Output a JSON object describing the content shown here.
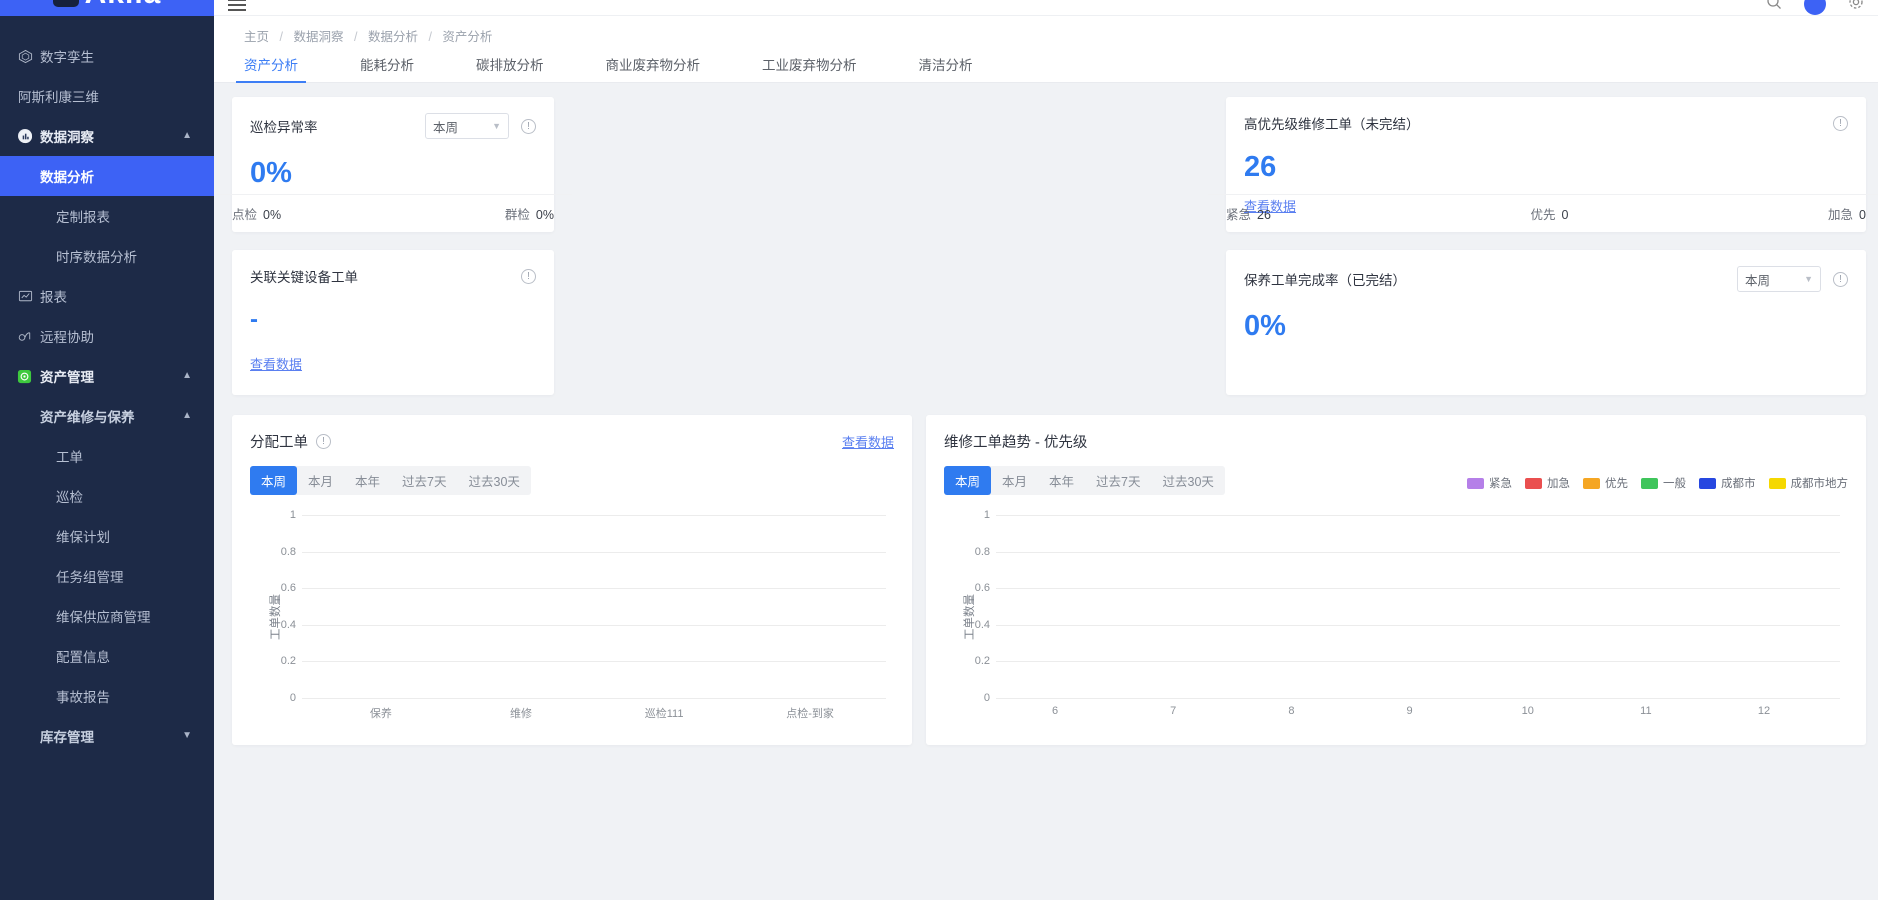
{
  "brand": {
    "logo_text": "Akila"
  },
  "sidebar": {
    "items": [
      {
        "label": "数字孪生",
        "icon": "cube-icon",
        "level": 1,
        "active": false,
        "chevron": ""
      },
      {
        "label": "阿斯利康三维",
        "icon": "",
        "level": 1,
        "active": false,
        "chevron": ""
      },
      {
        "label": "数据洞察",
        "icon": "insight-icon",
        "level": 1,
        "active": false,
        "chevron": "up"
      },
      {
        "label": "数据分析",
        "icon": "",
        "level": 3,
        "active": true,
        "chevron": ""
      },
      {
        "label": "定制报表",
        "icon": "",
        "level": 3,
        "active": false,
        "chevron": ""
      },
      {
        "label": "时序数据分析",
        "icon": "",
        "level": 3,
        "active": false,
        "chevron": ""
      },
      {
        "label": "报表",
        "icon": "report-icon",
        "level": 1,
        "active": false,
        "chevron": ""
      },
      {
        "label": "远程协助",
        "icon": "glasses-icon",
        "level": 1,
        "active": false,
        "chevron": ""
      },
      {
        "label": "资产管理",
        "icon": "asset-icon",
        "level": 1,
        "active": false,
        "chevron": "up"
      },
      {
        "label": "资产维修与保养",
        "icon": "",
        "level": 2,
        "active": false,
        "chevron": "up"
      },
      {
        "label": "工单",
        "icon": "",
        "level": 4,
        "active": false,
        "chevron": ""
      },
      {
        "label": "巡检",
        "icon": "",
        "level": 4,
        "active": false,
        "chevron": ""
      },
      {
        "label": "维保计划",
        "icon": "",
        "level": 4,
        "active": false,
        "chevron": ""
      },
      {
        "label": "任务组管理",
        "icon": "",
        "level": 4,
        "active": false,
        "chevron": ""
      },
      {
        "label": "维保供应商管理",
        "icon": "",
        "level": 4,
        "active": false,
        "chevron": ""
      },
      {
        "label": "配置信息",
        "icon": "",
        "level": 4,
        "active": false,
        "chevron": ""
      },
      {
        "label": "事故报告",
        "icon": "",
        "level": 4,
        "active": false,
        "chevron": ""
      },
      {
        "label": "库存管理",
        "icon": "",
        "level": 2,
        "active": false,
        "chevron": "down"
      }
    ]
  },
  "breadcrumb": {
    "items": [
      "主页",
      "数据洞察",
      "数据分析",
      "资产分析"
    ]
  },
  "tabs": [
    {
      "label": "资产分析",
      "active": true
    },
    {
      "label": "能耗分析",
      "active": false
    },
    {
      "label": "碳排放分析",
      "active": false
    },
    {
      "label": "商业废弃物分析",
      "active": false
    },
    {
      "label": "工业废弃物分析",
      "active": false
    },
    {
      "label": "清洁分析",
      "active": false
    }
  ],
  "cards": {
    "inspection_rate": {
      "title": "巡检异常率",
      "period": "本周",
      "value": "0%",
      "footer": [
        {
          "label": "点检",
          "value": "0%"
        },
        {
          "label": "群检",
          "value": "0%"
        }
      ]
    },
    "key_equipment": {
      "title": "关联关键设备工单",
      "value": "-",
      "link": "查看数据"
    },
    "high_priority": {
      "title": "高优先级维修工单（未完结）",
      "value": "26",
      "link": "查看数据",
      "footer": [
        {
          "label": "紧急",
          "value": "26"
        },
        {
          "label": "优先",
          "value": "0"
        },
        {
          "label": "加急",
          "value": "0"
        }
      ]
    },
    "maintenance_rate": {
      "title": "保养工单完成率（已完结）",
      "period": "本周",
      "value": "0%"
    }
  },
  "segments": [
    "本周",
    "本月",
    "本年",
    "过去7天",
    "过去30天"
  ],
  "chart_data": [
    {
      "id": "assigned_work_orders",
      "type": "bar",
      "title": "分配工单",
      "link": "查看数据",
      "active_segment": "本周",
      "ylabel": "工单数量",
      "xlabel": "",
      "categories": [
        "保养",
        "维修",
        "巡检111",
        "点检-到家"
      ],
      "values": [
        0,
        0,
        0,
        0
      ],
      "ylim": [
        0,
        1
      ],
      "yticks": [
        "0",
        "0.2",
        "0.4",
        "0.6",
        "0.8",
        "1"
      ],
      "grid": true,
      "legend": []
    },
    {
      "id": "repair_trend_priority",
      "type": "line",
      "title": "维修工单趋势 - 优先级",
      "active_segment": "本周",
      "ylabel": "工单数量",
      "xlabel": "",
      "x": [
        "6",
        "7",
        "8",
        "9",
        "10",
        "11",
        "12"
      ],
      "ylim": [
        0,
        1
      ],
      "yticks": [
        "0",
        "0.2",
        "0.4",
        "0.6",
        "0.8",
        "1"
      ],
      "grid": true,
      "legend_position": "top-right",
      "series": [
        {
          "name": "紧急",
          "color": "#b57fe8",
          "values": [
            0,
            0,
            0,
            0,
            0,
            0,
            0
          ]
        },
        {
          "name": "加急",
          "color": "#ea4f4f",
          "values": [
            0,
            0,
            0,
            0,
            0,
            0,
            0
          ]
        },
        {
          "name": "优先",
          "color": "#f5a623",
          "values": [
            0,
            0,
            0,
            0,
            0,
            0,
            0
          ]
        },
        {
          "name": "一般",
          "color": "#3fc55b",
          "values": [
            0,
            0,
            0,
            0,
            0,
            0,
            0
          ]
        },
        {
          "name": "成都市",
          "color": "#2747e0",
          "values": [
            0,
            0,
            0,
            0,
            0,
            0,
            0
          ]
        },
        {
          "name": "成都市地方",
          "color": "#f5d800",
          "values": [
            0,
            0,
            0,
            0,
            0,
            0,
            0
          ]
        }
      ]
    }
  ],
  "colors": {
    "accent": "#3d62f5",
    "sidebar_bg": "#1d2a47",
    "value_blue": "#2f7bf0"
  }
}
